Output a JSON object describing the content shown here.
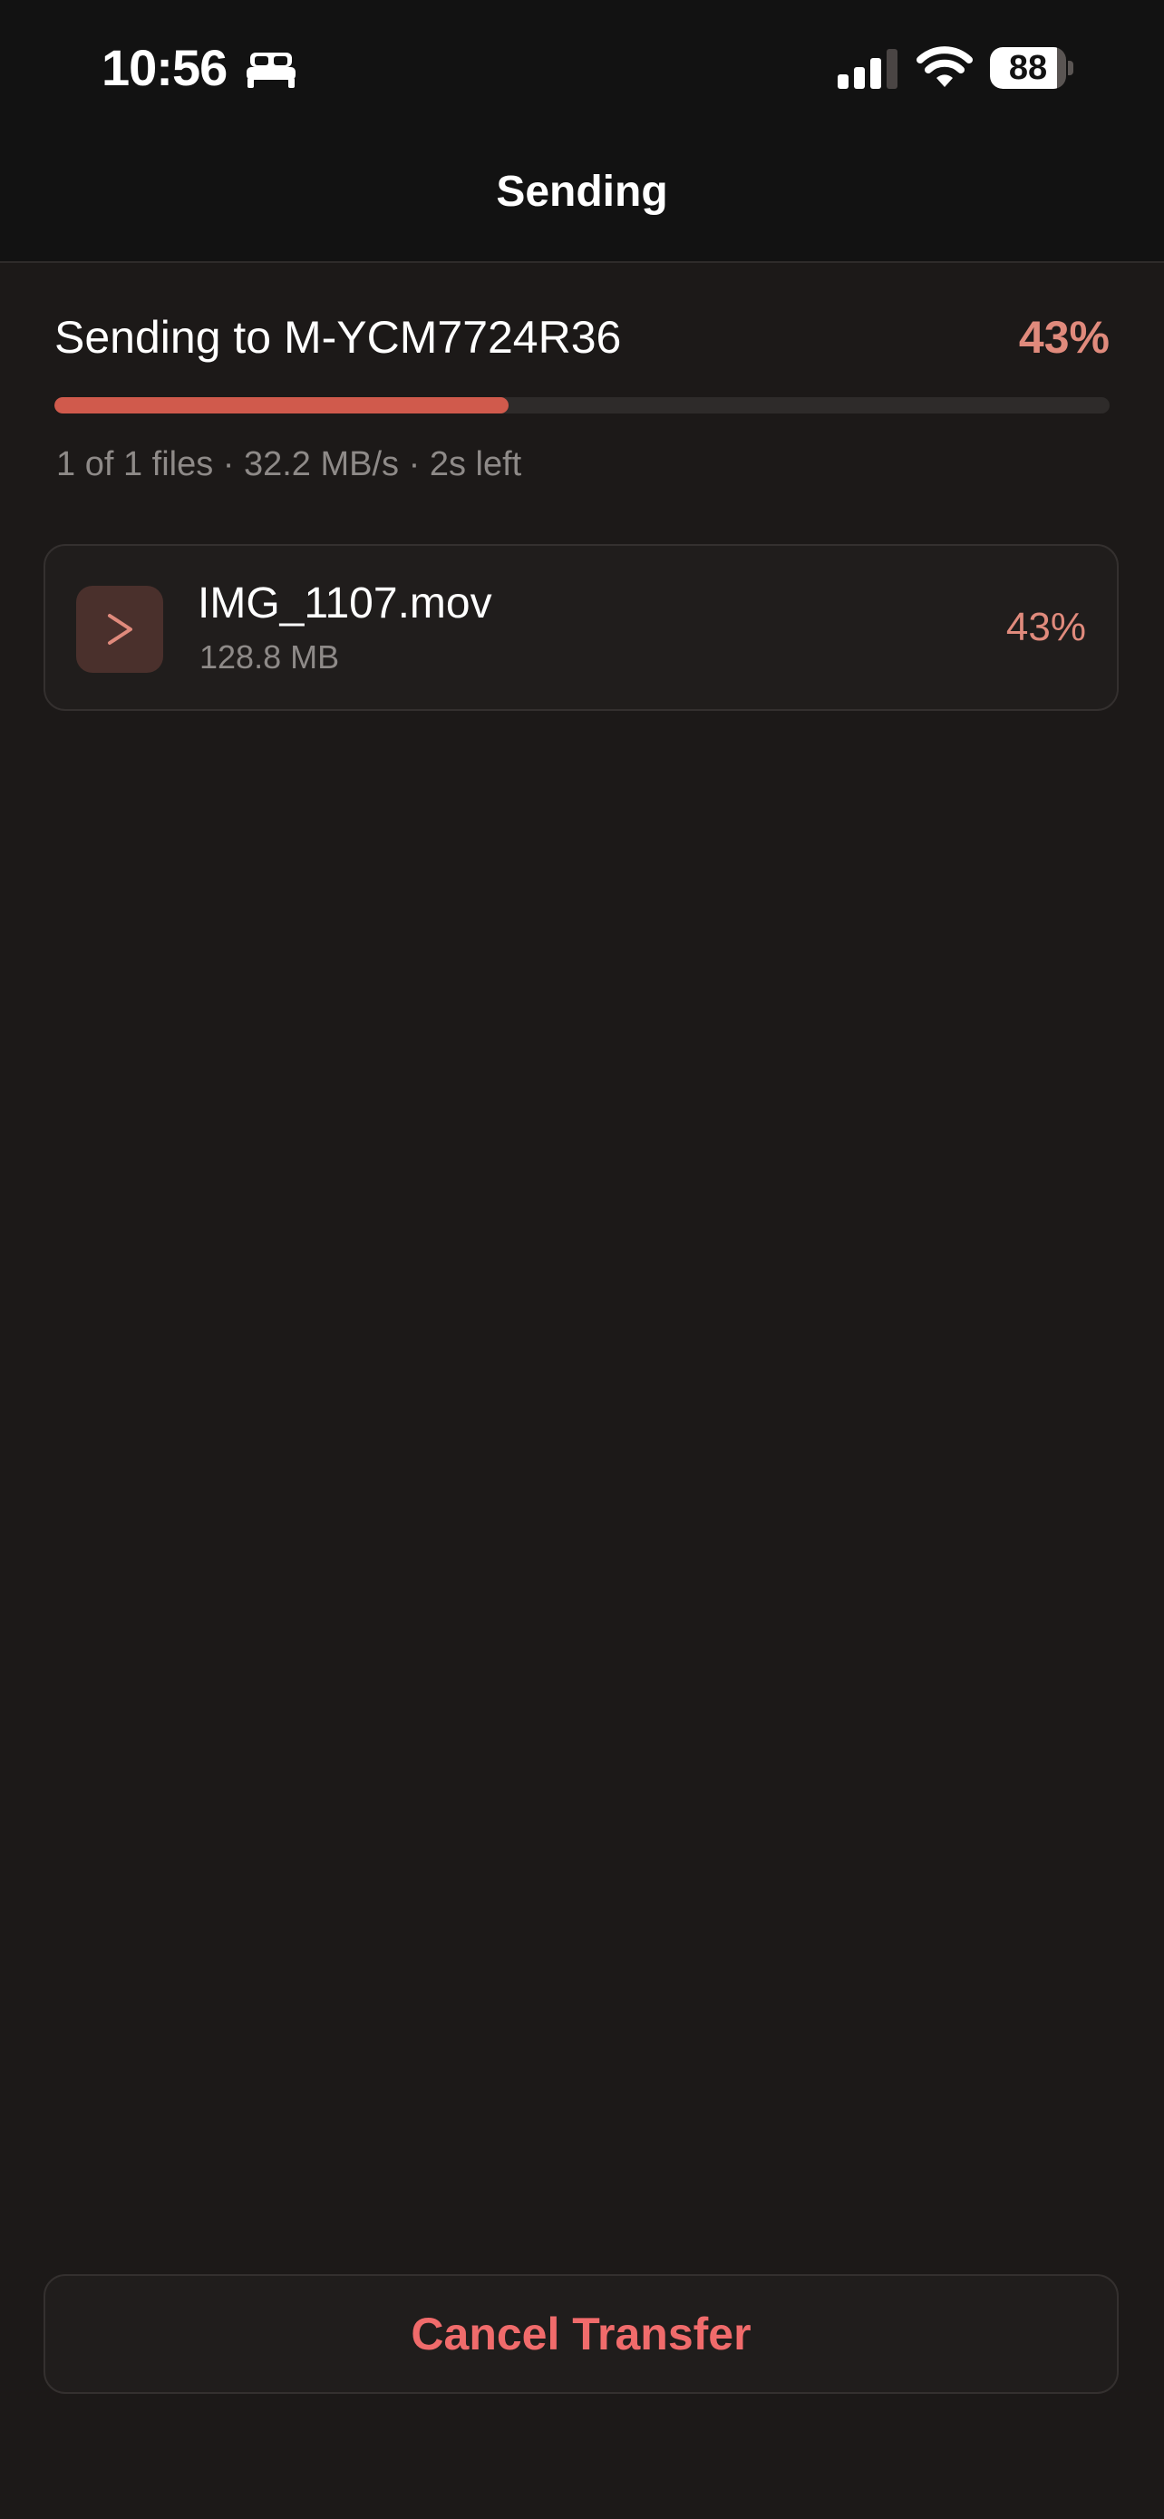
{
  "status_bar": {
    "time": "10:56",
    "battery_level": "88",
    "battery_fraction": 0.88
  },
  "icons": {
    "focus": "bed-icon",
    "signal": "cellular-signal-icon",
    "wifi": "wifi-icon",
    "battery": "battery-icon",
    "file": "video-file-icon"
  },
  "nav": {
    "title": "Sending"
  },
  "transfer": {
    "title": "Sending to M-YCM7724R36",
    "percent_label": "43%",
    "progress": 0.43,
    "stats": "1 of 1 files · 32.2 MB/s · 2s left"
  },
  "files": [
    {
      "name": "IMG_1107.mov",
      "size": "128.8 MB",
      "percent_label": "43%"
    }
  ],
  "actions": {
    "cancel_label": "Cancel Transfer"
  },
  "colors": {
    "accent": "#d05a4c",
    "accent_text": "#e08a7c",
    "destructive": "#f06b6b",
    "background": "#1c1918"
  }
}
